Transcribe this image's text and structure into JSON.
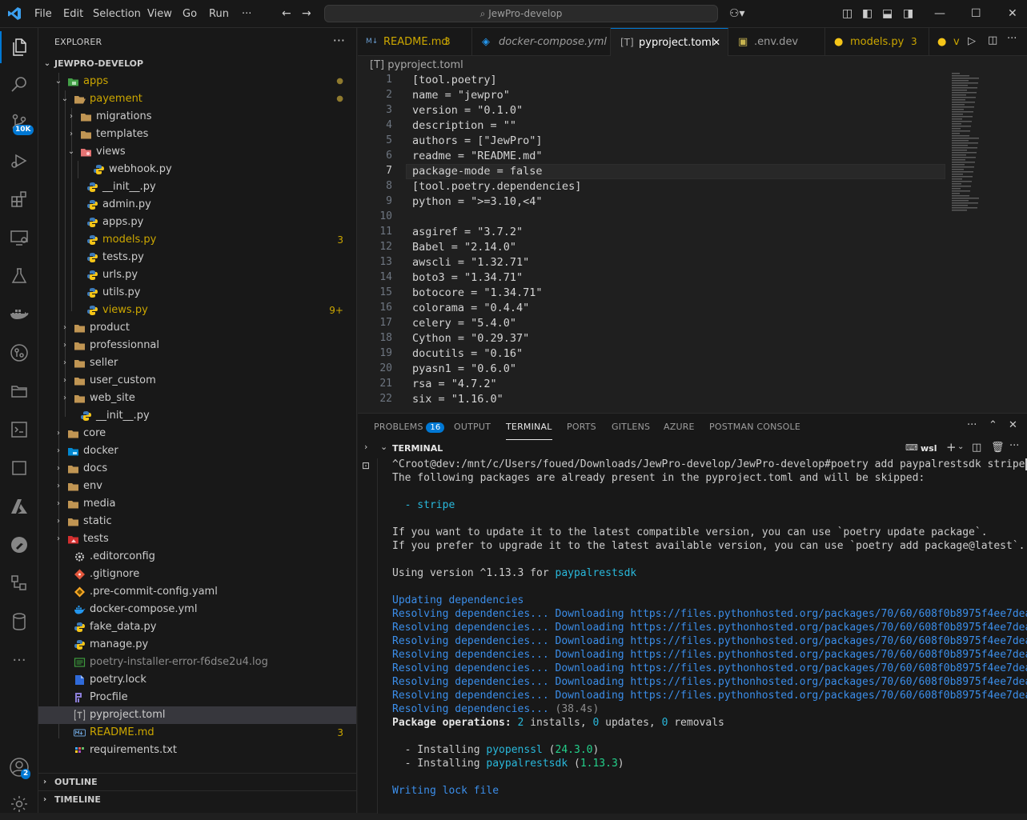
{
  "titlebar": {
    "menu": [
      "File",
      "Edit",
      "Selection",
      "View",
      "Go",
      "Run",
      "···"
    ],
    "search": "JewPro-develop"
  },
  "activity": {
    "source_control_badge": "10K",
    "accounts_badge": "2"
  },
  "explorer": {
    "header": "EXPLORER",
    "more": "···",
    "root": "JEWPRO-DEVELOP",
    "items": [
      {
        "label": "apps",
        "status": "●"
      },
      {
        "label": "payement",
        "status": "●"
      },
      {
        "label": "migrations"
      },
      {
        "label": "templates"
      },
      {
        "label": "views"
      },
      {
        "label": "webhook.py"
      },
      {
        "label": "__init__.py"
      },
      {
        "label": "admin.py"
      },
      {
        "label": "apps.py"
      },
      {
        "label": "models.py",
        "status": "3"
      },
      {
        "label": "tests.py"
      },
      {
        "label": "urls.py"
      },
      {
        "label": "utils.py"
      },
      {
        "label": "views.py",
        "status": "9+"
      },
      {
        "label": "product"
      },
      {
        "label": "professionnal"
      },
      {
        "label": "seller"
      },
      {
        "label": "user_custom"
      },
      {
        "label": "web_site"
      },
      {
        "label": "__init__.py"
      },
      {
        "label": "core"
      },
      {
        "label": "docker"
      },
      {
        "label": "docs"
      },
      {
        "label": "env"
      },
      {
        "label": "media"
      },
      {
        "label": "static"
      },
      {
        "label": "tests"
      },
      {
        "label": ".editorconfig"
      },
      {
        "label": ".gitignore"
      },
      {
        "label": ".pre-commit-config.yaml"
      },
      {
        "label": "docker-compose.yml"
      },
      {
        "label": "fake_data.py"
      },
      {
        "label": "manage.py"
      },
      {
        "label": "poetry-installer-error-f6dse2u4.log"
      },
      {
        "label": "poetry.lock"
      },
      {
        "label": "Procfile"
      },
      {
        "label": "pyproject.toml"
      },
      {
        "label": "README.md",
        "status": "3"
      },
      {
        "label": "requirements.txt"
      }
    ],
    "outline": "OUTLINE",
    "timeline": "TIMELINE"
  },
  "tabs": [
    {
      "icon": "M↓",
      "label": "README.md",
      "badge": "3"
    },
    {
      "label": "docker-compose.yml"
    },
    {
      "icon": "[T]",
      "label": "pyproject.toml",
      "close": "✕"
    },
    {
      "label": ".env.dev"
    },
    {
      "label": "models.py",
      "badge": "3"
    },
    {
      "label": "v"
    }
  ],
  "breadcrumb": {
    "icon": "[T]",
    "file": "pyproject.toml"
  },
  "editor": {
    "current_line": 7,
    "lines": [
      "[tool.poetry]",
      "name = \"jewpro\"",
      "version = \"0.1.0\"",
      "description = \"\"",
      "authors = [\"JewPro\"]",
      "readme = \"README.md\"",
      "package-mode = false",
      "[tool.poetry.dependencies]",
      "python = \">=3.10,<4\"",
      "",
      "asgiref = \"3.7.2\"",
      "Babel = \"2.14.0\"",
      "awscli = \"1.32.71\"",
      "boto3 = \"1.34.71\"",
      "botocore = \"1.34.71\"",
      "colorama = \"0.4.4\"",
      "celery = \"5.4.0\"",
      "Cython = \"0.29.37\"",
      "docutils = \"0.16\"",
      "pyasn1 = \"0.6.0\"",
      "rsa = \"4.7.2\"",
      "six = \"1.16.0\""
    ]
  },
  "panel": {
    "tabs": [
      "PROBLEMS",
      "OUTPUT",
      "TERMINAL",
      "PORTS",
      "GITLENS",
      "AZURE",
      "POSTMAN CONSOLE"
    ],
    "problems_badge": "16",
    "active_tab": "TERMINAL",
    "terminal_header": "TERMINAL",
    "shell": "wsl",
    "more": "···"
  },
  "terminal": {
    "prompt": "^Croot@dev:/mnt/c/Users/foued/Downloads/JewPro-develop/JewPro-develop#",
    "command": "poetry add paypalrestsdk stripe",
    "skipped_msg": "The following packages are already present in the pyproject.toml and will be skipped:",
    "skipped_pkg": "  - stripe",
    "hint1": "If you want to update it to the latest compatible version, you can use `poetry update package`.",
    "hint2": "If you prefer to upgrade it to the latest available version, you can use `poetry add package@latest`.",
    "using_prefix": "Using version ^1.13.3 for ",
    "using_pkg": "paypalrestsdk",
    "updating": "Updating dependencies",
    "resolving": "Resolving dependencies... ",
    "downloading": "Downloading https://files.pythonhosted.org/packages/70/60/608f0b8975f4ee7dea",
    "resolving_done_time": "(38.4s)",
    "pkg_ops_label": "Package operations: ",
    "installs": "2",
    "installs_txt": " installs, ",
    "updates": "0",
    "updates_txt": " updates, ",
    "removals": "0",
    "removals_txt": " removals",
    "install1_pkg": "pyopenssl",
    "install1_ver": "24.3.0",
    "install2_pkg": "paypalrestsdk",
    "install2_ver": "1.13.3",
    "install_prefix": "  - Installing ",
    "writing": "Writing lock file"
  },
  "colors": {
    "accent": "#0078d4",
    "modified": "#cca700",
    "link": "#3b8eea"
  }
}
